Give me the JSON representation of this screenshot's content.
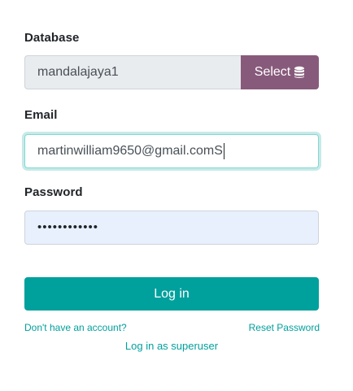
{
  "database": {
    "label": "Database",
    "value": "mandalajaya1",
    "select_label": "Select",
    "select_icon": "database-icon"
  },
  "email": {
    "label": "Email",
    "value": "martinwilliam9650@gmail.comS"
  },
  "password": {
    "label": "Password",
    "masked_value": "••••••••••••"
  },
  "login_button": {
    "label": "Log in"
  },
  "links": {
    "signup": "Don't have an account?",
    "reset": "Reset Password",
    "superuser": "Log in as superuser"
  },
  "colors": {
    "primary": "#00a09d",
    "select_button": "#875a7b"
  }
}
